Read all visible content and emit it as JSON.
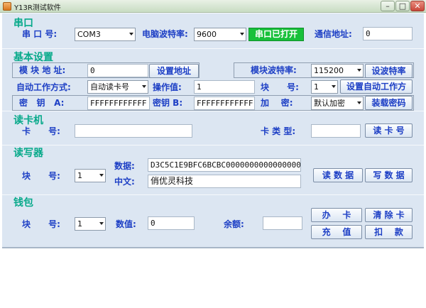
{
  "window": {
    "title": "Y13R测试软件",
    "min": "–",
    "max": "□",
    "close": "✕"
  },
  "serial": {
    "title": "串口",
    "port_label": "串 口 号:",
    "port_value": "COM3",
    "baud_label": "电脑波特率:",
    "baud_value": "9600",
    "status": "串口已打开",
    "comm_addr_label": "通信地址:",
    "comm_addr_value": "0"
  },
  "basic": {
    "title": "基本设置",
    "module_addr_label": "模 块 地 址:",
    "module_addr_value": "0",
    "set_addr_btn": "设置地址",
    "module_baud_label": "模块波特率:",
    "module_baud_value": "115200",
    "set_baud_btn": "设波特率",
    "auto_mode_label": "自动工作方式:",
    "auto_mode_value": "自动读卡号",
    "op_value_label": "操作值:",
    "op_value": "1",
    "block_label": "块      号:",
    "block_value": "1",
    "set_auto_btn": "设置自动工作方",
    "key_a_label": "密   钥   A:",
    "key_a_value": "FFFFFFFFFFFF",
    "key_b_label": "密钥 B:",
    "key_b_value": "FFFFFFFFFFFF",
    "encrypt_label": "加    密:",
    "encrypt_value": "默认加密",
    "load_key_btn": "装载密码"
  },
  "reader": {
    "title": "读卡机",
    "card_no_label": "卡      号:",
    "card_no_value": "",
    "card_type_label": "卡 类 型:",
    "card_type_value": "",
    "read_card_btn": "读 卡 号"
  },
  "rw": {
    "title": "读写器",
    "block_label": "块      号:",
    "block_value": "1",
    "data_label": "数据:",
    "data_value": "D3C5C1E9BFC6BCBC0000000000000000",
    "chinese_label": "中文:",
    "chinese_value": "俏优灵科技",
    "read_btn": "读 数 据",
    "write_btn": "写 数 据"
  },
  "wallet": {
    "title": "钱包",
    "block_label": "块      号:",
    "block_value": "1",
    "value_label": "数值:",
    "value": "0",
    "balance_label": "余额:",
    "balance_value": "",
    "open_btn": "办    卡",
    "clear_btn": "清 除 卡",
    "recharge_btn": "充    值",
    "deduct_btn": "扣    款"
  },
  "log": {
    "text": ""
  }
}
